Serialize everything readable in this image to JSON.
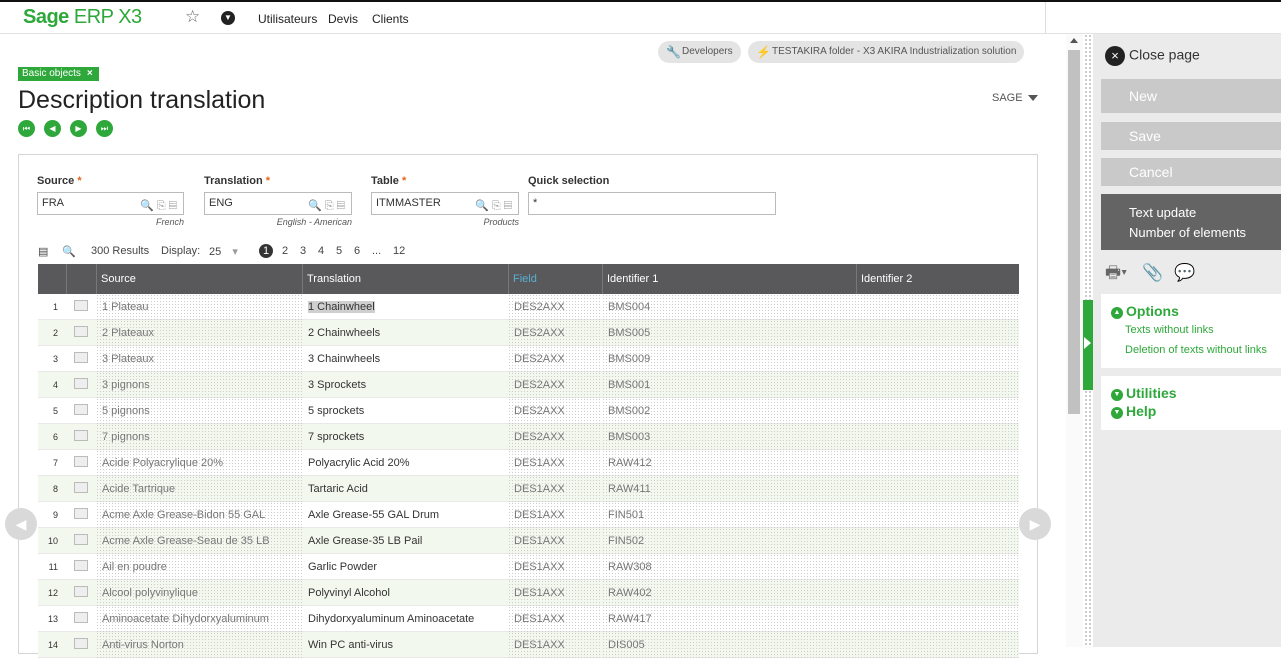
{
  "topbar": {
    "logo_bold": "Sage",
    "logo_light": "ERP X3",
    "nav": [
      "Utilisateurs",
      "Devis",
      "Clients"
    ]
  },
  "pills": {
    "developers": "Developers",
    "folder": "TESTAKIRA folder - X3 AKIRA Industrialization solution"
  },
  "tag": "Basic objects",
  "title": "Description translation",
  "sage_menu": "SAGE",
  "fields": {
    "source": {
      "label": "Source",
      "value": "FRA",
      "sub": "French"
    },
    "translation": {
      "label": "Translation",
      "value": "ENG",
      "sub": "English - American"
    },
    "table": {
      "label": "Table",
      "value": "ITMMASTER",
      "sub": "Products"
    },
    "quick": {
      "label": "Quick selection",
      "value": "*"
    }
  },
  "toolbar": {
    "results": "300 Results",
    "display_label": "Display:",
    "display_value": "25",
    "pages": [
      "1",
      "2",
      "3",
      "4",
      "5",
      "6",
      "...",
      "12"
    ]
  },
  "grid": {
    "headers": [
      "Source",
      "Translation",
      "Field",
      "Identifier 1",
      "Identifier 2"
    ],
    "rows": [
      {
        "n": "1",
        "source": "1 Plateau",
        "translation": "1 Chainwheel",
        "field": "DES2AXX",
        "id1": "BMS004"
      },
      {
        "n": "2",
        "source": "2 Plateaux",
        "translation": "2 Chainwheels",
        "field": "DES2AXX",
        "id1": "BMS005"
      },
      {
        "n": "3",
        "source": "3 Plateaux",
        "translation": "3 Chainwheels",
        "field": "DES2AXX",
        "id1": "BMS009"
      },
      {
        "n": "4",
        "source": "3 pignons",
        "translation": "3 Sprockets",
        "field": "DES2AXX",
        "id1": "BMS001"
      },
      {
        "n": "5",
        "source": "5 pignons",
        "translation": "5 sprockets",
        "field": "DES2AXX",
        "id1": "BMS002"
      },
      {
        "n": "6",
        "source": "7 pignons",
        "translation": "7 sprockets",
        "field": "DES2AXX",
        "id1": "BMS003"
      },
      {
        "n": "7",
        "source": "Acide Polyacrylique  20%",
        "translation": "Polyacrylic Acid 20%",
        "field": "DES1AXX",
        "id1": "RAW412"
      },
      {
        "n": "8",
        "source": "Acide Tartrique",
        "translation": "Tartaric Acid",
        "field": "DES1AXX",
        "id1": "RAW411"
      },
      {
        "n": "9",
        "source": "Acme Axle Grease-Bidon 55 GAL",
        "translation": "Axle Grease-55 GAL Drum",
        "field": "DES1AXX",
        "id1": "FIN501"
      },
      {
        "n": "10",
        "source": "Acme Axle Grease-Seau de 35 LB",
        "translation": "Axle Grease-35 LB Pail",
        "field": "DES1AXX",
        "id1": "FIN502"
      },
      {
        "n": "11",
        "source": "Ail en poudre",
        "translation": "Garlic Powder",
        "field": "DES1AXX",
        "id1": "RAW308"
      },
      {
        "n": "12",
        "source": "Alcool polyvinylique",
        "translation": "Polyvinyl Alcohol",
        "field": "DES1AXX",
        "id1": "RAW402"
      },
      {
        "n": "13",
        "source": "Aminoacetate Dihydorxyaluminum",
        "translation": "Dihydorxyaluminum Aminoacetate",
        "field": "DES1AXX",
        "id1": "RAW417"
      },
      {
        "n": "14",
        "source": "Anti-virus Norton",
        "translation": "Win PC anti-virus",
        "field": "DES1AXX",
        "id1": "DIS005"
      }
    ]
  },
  "side": {
    "close": "Close page",
    "new": "New",
    "save": "Save",
    "cancel": "Cancel",
    "text_update": "Text update",
    "num_elements": "Number of elements",
    "options": "Options",
    "opt_links": [
      "Texts without links",
      "Deletion of texts without links"
    ],
    "utilities": "Utilities",
    "help": "Help"
  },
  "colors": {
    "brand": "#2ea83a",
    "header": "#59595b",
    "field_header": "#58b0d6"
  }
}
